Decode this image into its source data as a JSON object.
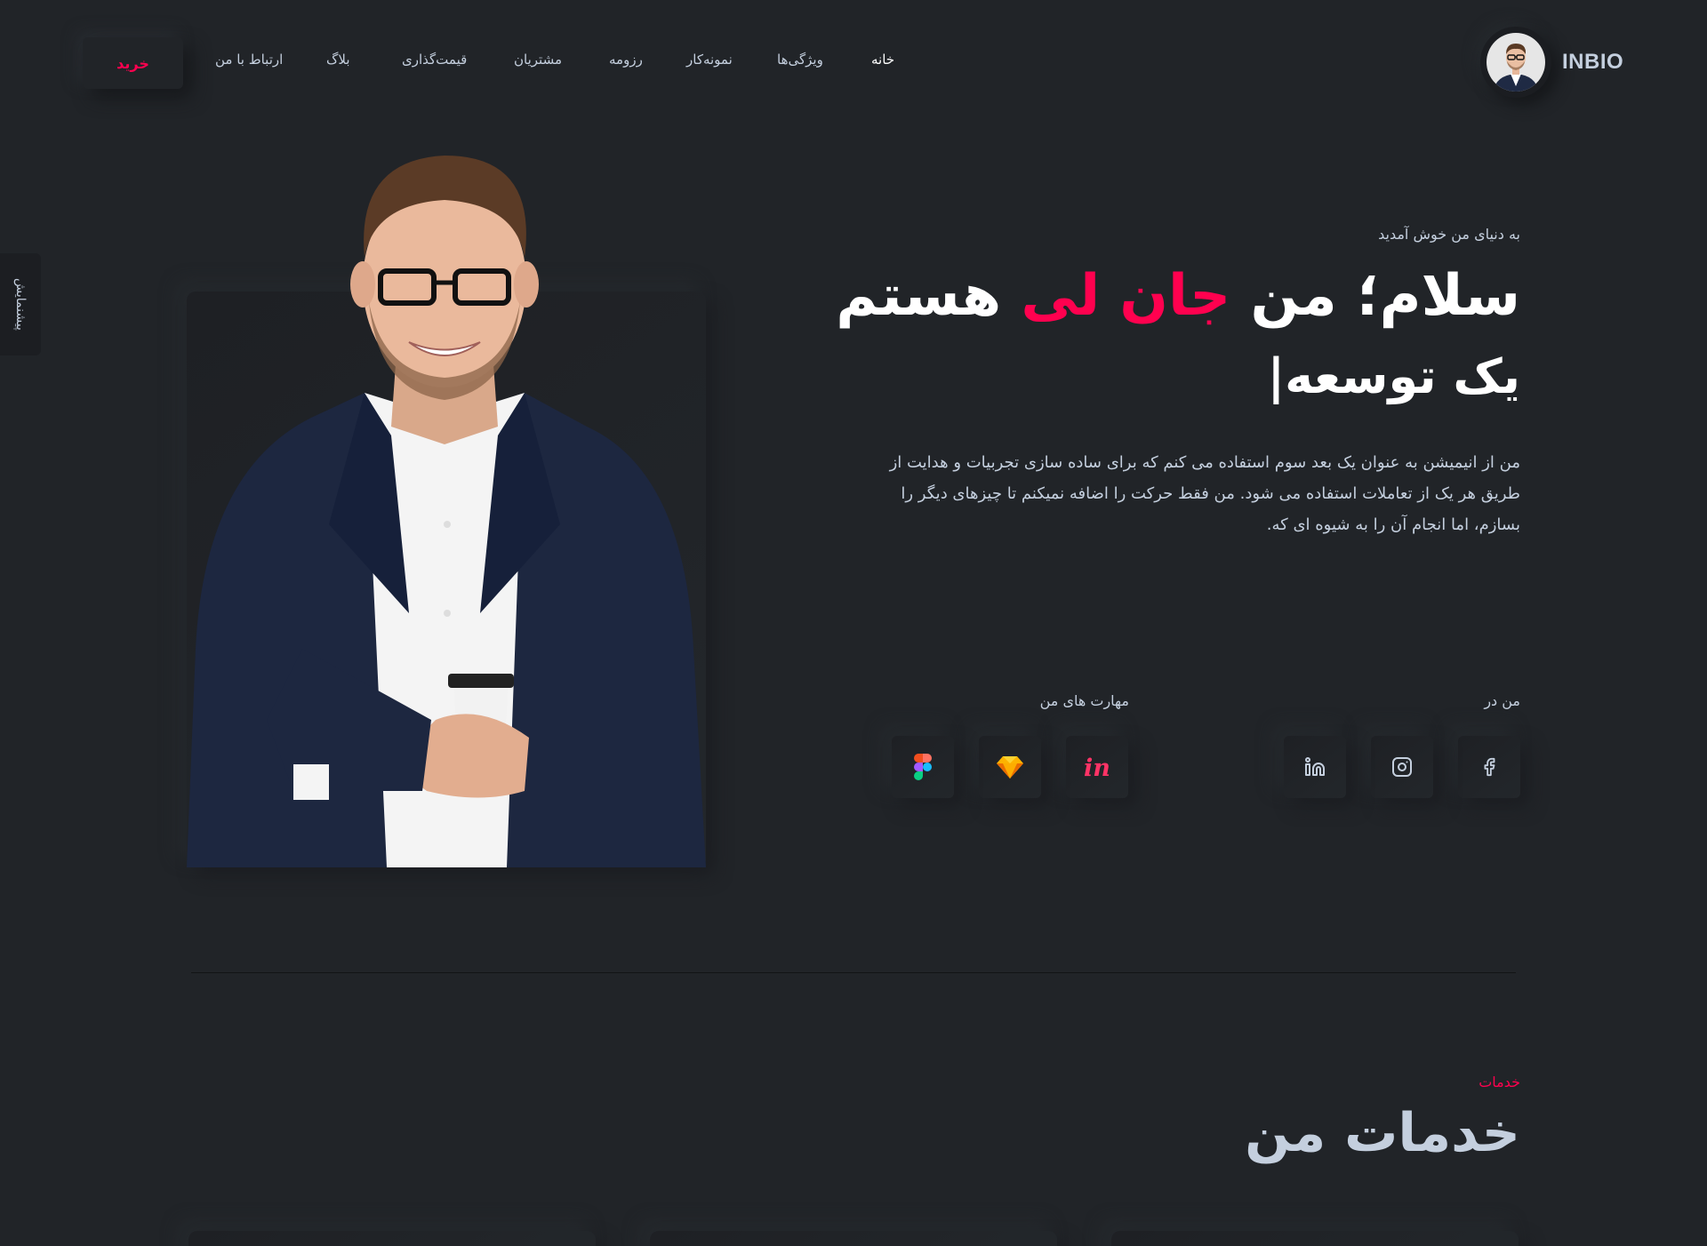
{
  "brand": {
    "name": "INBIO"
  },
  "nav": {
    "items": [
      {
        "label": "خانه"
      },
      {
        "label": "ویژگی‌ها"
      },
      {
        "label": "نمونه‌کار"
      },
      {
        "label": "رزومه"
      },
      {
        "label": "مشتریان"
      },
      {
        "label": "قیمت‌گذاری"
      },
      {
        "label": "بلاگ"
      },
      {
        "label": "ارتباط با من"
      }
    ],
    "buy_label": "خرید"
  },
  "side_tab": {
    "label": "پیشنمایش"
  },
  "hero": {
    "welcome": "به دنیای من خوش آمدید",
    "title_before": "سلام؛ من ",
    "title_accent": "جان لی",
    "title_after": " هستم",
    "role": "یک توسعه|",
    "description": "من از انیمیشن به عنوان یک بعد سوم استفاده می کنم که برای ساده سازی تجربیات و هدایت از طریق هر یک از تعاملات استفاده می شود. من فقط حرکت را اضافه نمیکنم تا چیزهای دیگر را بسازم، اما انجام آن را به شیوه ای که."
  },
  "social": {
    "label": "من در",
    "icons": [
      "facebook-icon",
      "instagram-icon",
      "linkedin-icon"
    ]
  },
  "skills": {
    "label": "مهارت های من",
    "icons": [
      "invision-icon",
      "sketch-icon",
      "figma-icon"
    ]
  },
  "services": {
    "kicker": "خدمات",
    "title": "خدمات من"
  },
  "colors": {
    "background": "#212428",
    "accent": "#ff014f",
    "text": "#c4cfde",
    "heading": "#ffffff"
  }
}
